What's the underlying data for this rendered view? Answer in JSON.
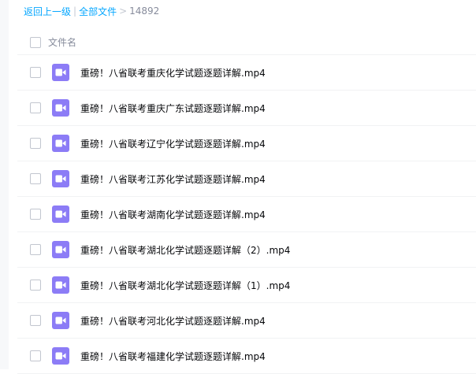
{
  "breadcrumb": {
    "back_label": "返回上一级",
    "separator": "|",
    "all_files_label": "全部文件",
    "arrow": ">",
    "current_folder": "14892"
  },
  "list_header": {
    "column_title": "文件名"
  },
  "files": [
    {
      "name": "重磅！八省联考重庆化学试题逐题详解.mp4",
      "icon": "video-file-icon"
    },
    {
      "name": "重磅！八省联考重庆广东试题逐题详解.mp4",
      "icon": "video-file-icon"
    },
    {
      "name": "重磅！八省联考辽宁化学试题逐题详解.mp4",
      "icon": "video-file-icon"
    },
    {
      "name": "重磅！八省联考江苏化学试题逐题详解.mp4",
      "icon": "video-file-icon"
    },
    {
      "name": "重磅！八省联考湖南化学试题逐题详解.mp4",
      "icon": "video-file-icon"
    },
    {
      "name": "重磅！八省联考湖北化学试题逐题详解（2）.mp4",
      "icon": "video-file-icon"
    },
    {
      "name": "重磅！八省联考湖北化学试题逐题详解（1）.mp4",
      "icon": "video-file-icon"
    },
    {
      "name": "重磅！八省联考河北化学试题逐题详解.mp4",
      "icon": "video-file-icon"
    },
    {
      "name": "重磅！八省联考福建化学试题逐题详解.mp4",
      "icon": "video-file-icon"
    }
  ],
  "colors": {
    "link": "#06a7ff",
    "video_icon": "#8c7cf6",
    "file_text": "#06070a",
    "muted_text": "#878c9c"
  }
}
